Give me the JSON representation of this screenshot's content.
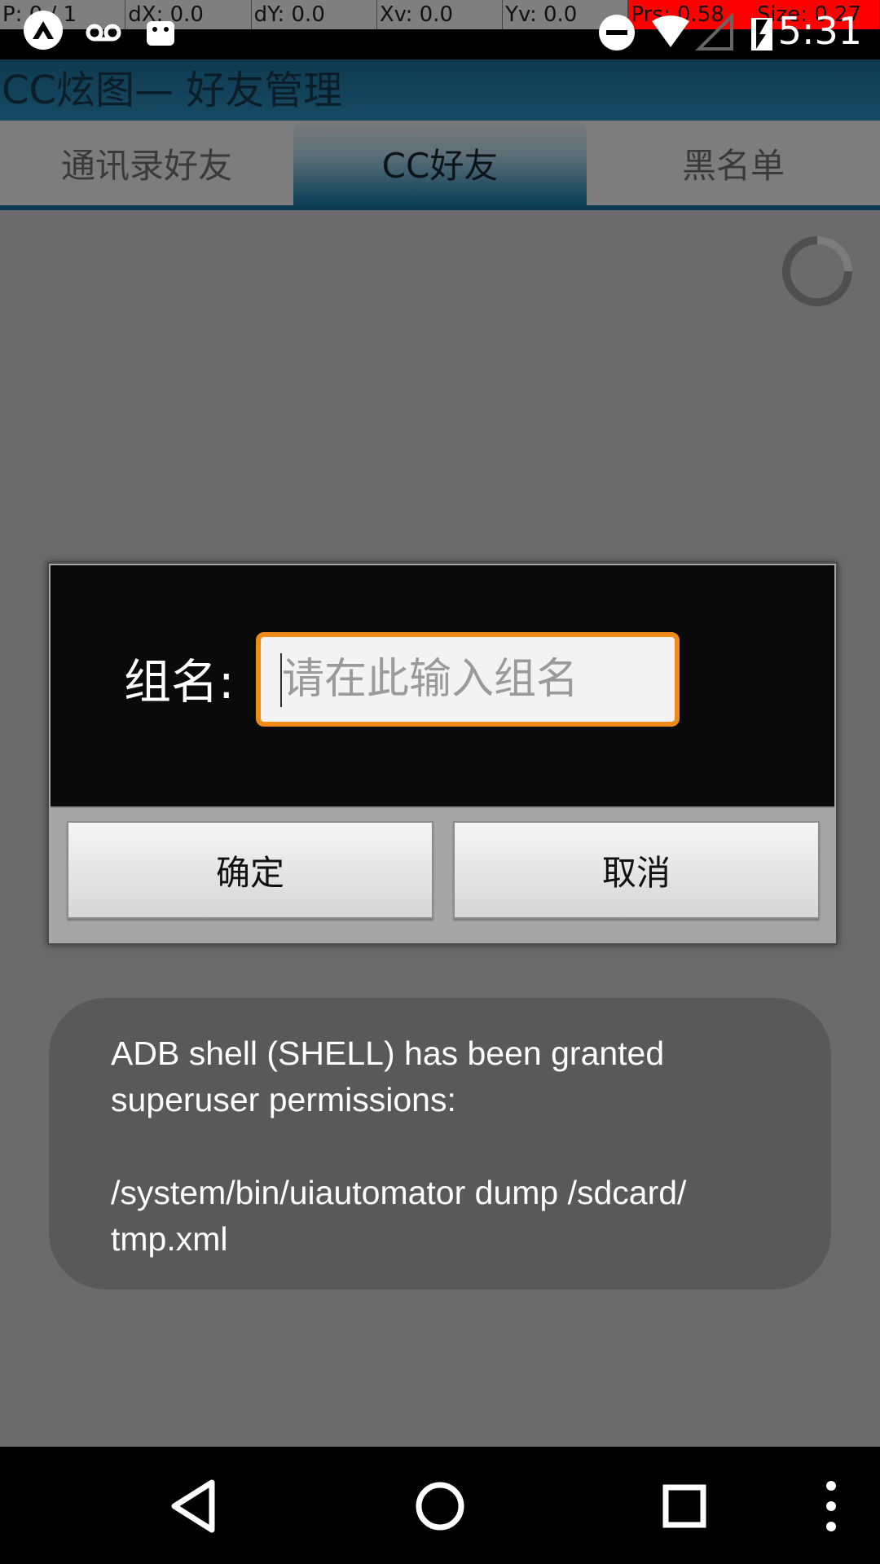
{
  "pointer_overlay": {
    "cells": [
      "P: 0 / 1",
      "dX: 0.0",
      "dY: 0.0",
      "Xv: 0.0",
      "Yv: 0.0",
      "Prs: 0.58",
      "Size: 0.27"
    ]
  },
  "status_bar": {
    "time": "5:31",
    "icons": [
      "app-icon",
      "voicemail-icon",
      "android-icon",
      "do-not-disturb-icon",
      "wifi-icon",
      "signal-icon",
      "battery-icon"
    ]
  },
  "action_bar": {
    "title": "CC炫图— 好友管理"
  },
  "tabs": [
    {
      "label": "通讯录好友",
      "active": false
    },
    {
      "label": "CC好友",
      "active": true
    },
    {
      "label": "黑名单",
      "active": false
    }
  ],
  "dialog": {
    "label": "组名:",
    "input_placeholder": "请在此输入组名",
    "ok_label": "确定",
    "cancel_label": "取消"
  },
  "toast": {
    "message": "ADB shell (SHELL) has been granted\nsuperuser permissions:\n\n/system/bin/uiautomator dump /sdcard/\ntmp.xml"
  },
  "nav_bar": {
    "icons": [
      "back-icon",
      "home-icon",
      "recents-icon",
      "menu-icon"
    ]
  },
  "colors": {
    "accent": "#f08b1a",
    "action_bar": "#164a63",
    "tab_indicator": "#0b3a52"
  }
}
